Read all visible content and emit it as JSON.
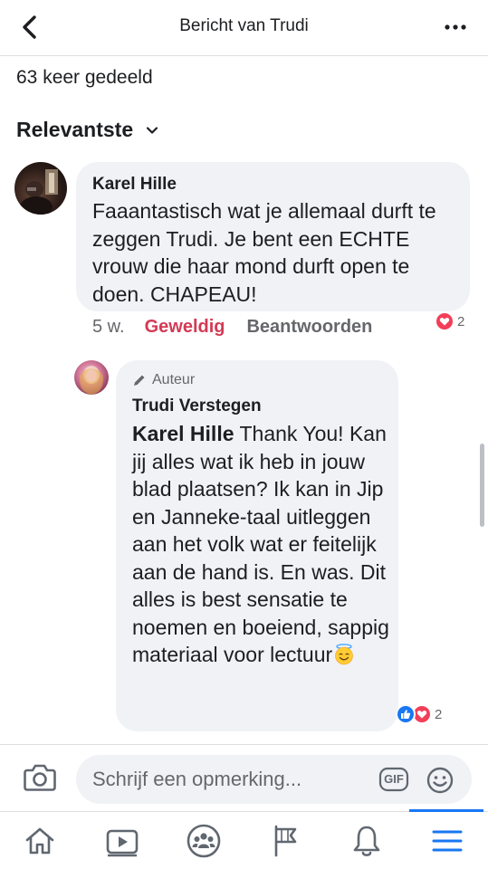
{
  "header": {
    "title": "Bericht van Trudi",
    "back_icon": "chevron-left-icon",
    "more_icon": "more-horizontal-icon"
  },
  "post": {
    "shares": "63 keer gedeeld"
  },
  "sort": {
    "label": "Relevantste",
    "icon": "chevron-down-icon"
  },
  "comments": [
    {
      "author": "Karel Hille",
      "text": "Faaantastisch wat je allemaal durft te zeggen Trudi. Je bent een ECHTE vrouw die haar mond durft open te doen. CHAPEAU!",
      "time": "5 w.",
      "like_label": "Geweldig",
      "reply_label": "Beantwoorden",
      "reaction_count": "2",
      "reactions": [
        "heart"
      ]
    },
    {
      "badge": "Auteur",
      "author": "Trudi Verstegen",
      "mention": "Karel Hille",
      "text": " Thank You! Kan jij alles wat ik heb in jouw blad plaatsen? Ik kan in Jip en Janneke-taal uitleggen aan het volk wat er feitelijk aan de hand is. En was. Dit alles is best sensatie te noemen en boeiend, sappig materiaal voor lectuur",
      "emoji": "smiling-face-with-halo",
      "reaction_count": "2",
      "reactions": [
        "like",
        "heart"
      ]
    }
  ],
  "composer": {
    "placeholder": "Schrijf een opmerking...",
    "gif_label": "GIF"
  },
  "tabs": [
    {
      "icon": "home-icon"
    },
    {
      "icon": "video-icon"
    },
    {
      "icon": "groups-icon"
    },
    {
      "icon": "pages-flag-icon"
    },
    {
      "icon": "bell-icon"
    },
    {
      "icon": "menu-icon",
      "active": true
    }
  ],
  "colors": {
    "accent": "#1877f2",
    "love": "#f33e58",
    "love_text": "#d33a55",
    "bubble": "#f0f2f5",
    "secondary_text": "#65676b"
  }
}
